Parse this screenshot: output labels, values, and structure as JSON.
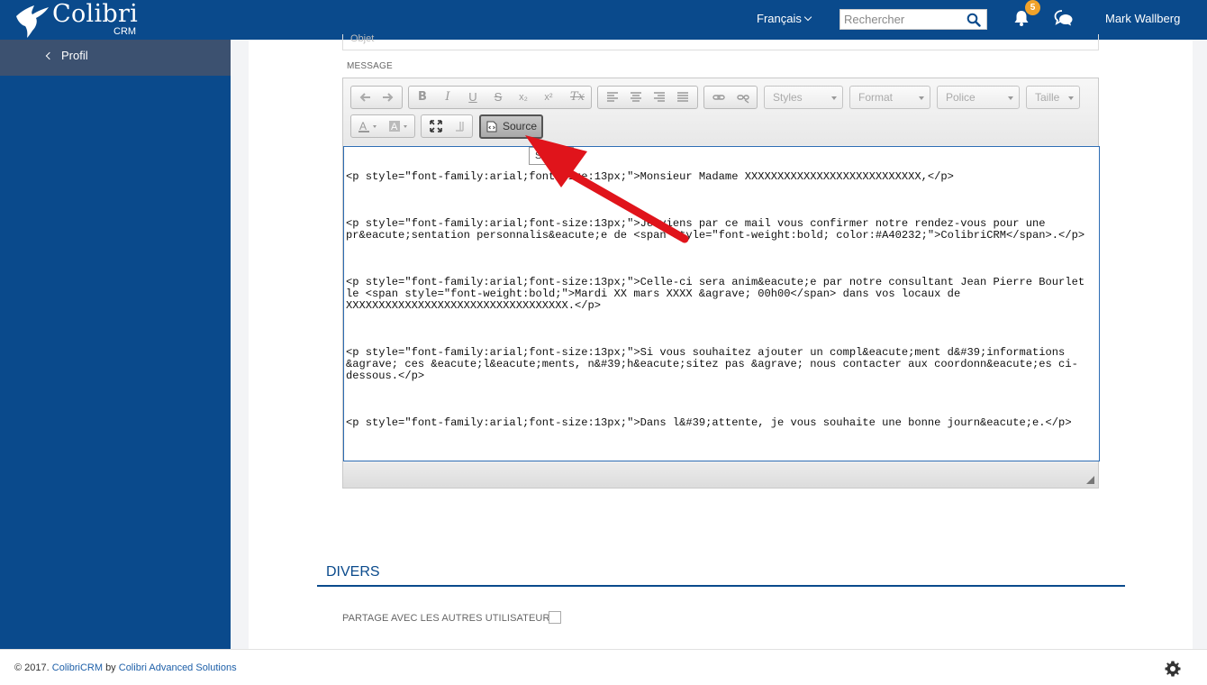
{
  "brand": {
    "name": "Colibri",
    "sub": "CRM"
  },
  "header": {
    "language": "Français",
    "search_placeholder": "Rechercher",
    "notifications_count": "5",
    "user_name": "Mark Wallberg"
  },
  "sidebar": {
    "items": [
      {
        "label": "Profil",
        "icon": "chevron-left-icon"
      }
    ]
  },
  "form": {
    "objet_placeholder": "Objet",
    "message_label": "MESSAGE",
    "section_title": "DIVERS",
    "share_label": "PARTAGE AVEC LES AUTRES UTILISATEURS",
    "share_checked": false
  },
  "editor": {
    "toolbar": {
      "row1": {
        "history": [
          "undo-icon",
          "redo-icon"
        ],
        "basic": [
          "B",
          "I",
          "U",
          "S",
          "x₂",
          "x²",
          "Tx"
        ],
        "align": [
          "align-left-icon",
          "align-center-icon",
          "align-right-icon",
          "align-justify-icon"
        ],
        "links": [
          "link-icon",
          "unlink-icon"
        ],
        "combos": [
          "Styles",
          "Format",
          "Police",
          "Taille"
        ]
      },
      "row2": {
        "colors": [
          "text-color-icon",
          "background-color-icon"
        ],
        "tools": [
          "maximize-icon",
          "show-blocks-icon"
        ],
        "source_label": "Source",
        "source_active": true
      },
      "tooltip": "S"
    },
    "source_lines": [
      "<p style=\"font-family:arial;font-size:13px;\">Monsieur Madame XXXXXXXXXXXXXXXXXXXXXXXXXXX,</p>",
      "<p style=\"font-family:arial;font-size:13px;\">Je viens par ce mail vous confirmer notre rendez-vous pour une pr&eacute;sentation personnalis&eacute;e de <span style=\"font-weight:bold; color:#A40232;\">ColibriCRM</span>.</p>",
      "<p style=\"font-family:arial;font-size:13px;\">Celle-ci sera anim&eacute;e par notre consultant Jean Pierre Bourlet le <span style=\"font-weight:bold;\">Mardi XX mars XXXX &agrave; 00h00</span> dans vos locaux de XXXXXXXXXXXXXXXXXXXXXXXXXXXXXXXXXX.</p>",
      "<p style=\"font-family:arial;font-size:13px;\">Si vous souhaitez ajouter un compl&eacute;ment d&#39;informations &agrave; ces &eacute;l&eacute;ments, n&#39;h&eacute;sitez pas &agrave; nous contacter aux coordonn&eacute;es ci-dessous.</p>",
      "<p style=\"font-family:arial;font-size:13px;\">Dans l&#39;attente, je vous souhaite une bonne journ&eacute;e.</p>"
    ]
  },
  "footer": {
    "copyright": "© 2017.",
    "product": "ColibriCRM",
    "by": "by",
    "company": "Colibri Advanced Solutions"
  },
  "colors": {
    "header": "#0a4a8c",
    "sidebar_active": "#3c5170",
    "badge": "#f0a22a",
    "annotation_arrow": "#e0141b"
  }
}
